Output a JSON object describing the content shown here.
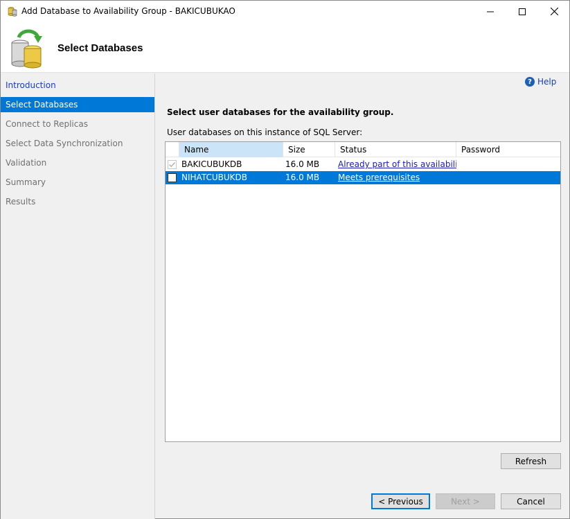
{
  "window": {
    "title": "Add Database to Availability Group - BAKICUBUKAO"
  },
  "header": {
    "page_title": "Select Databases"
  },
  "nav": {
    "items": [
      {
        "label": "Introduction",
        "state": "done"
      },
      {
        "label": "Select Databases",
        "state": "active"
      },
      {
        "label": "Connect to Replicas",
        "state": "pending"
      },
      {
        "label": "Select Data Synchronization",
        "state": "pending"
      },
      {
        "label": "Validation",
        "state": "pending"
      },
      {
        "label": "Summary",
        "state": "pending"
      },
      {
        "label": "Results",
        "state": "pending"
      }
    ]
  },
  "help": {
    "label": "Help"
  },
  "main": {
    "heading": "Select user databases for the availability group.",
    "grid_caption": "User databases on this instance of SQL Server:"
  },
  "grid": {
    "columns": [
      "Name",
      "Size",
      "Status",
      "Password"
    ],
    "rows": [
      {
        "checked": true,
        "enabled": false,
        "name": "BAKICUBUKDB",
        "size": "16.0 MB",
        "status": "Already part of this availabilit...",
        "password": ""
      },
      {
        "checked": false,
        "enabled": true,
        "name": "NIHATCUBUKDB",
        "size": "16.0 MB",
        "status": "Meets prerequisites",
        "password": ""
      }
    ]
  },
  "buttons": {
    "refresh": "Refresh",
    "previous": "< Previous",
    "next": "Next >",
    "cancel": "Cancel"
  },
  "colors": {
    "accent": "#0078d7",
    "link": "#1a3cc0",
    "header_selected": "#cce4f7"
  }
}
